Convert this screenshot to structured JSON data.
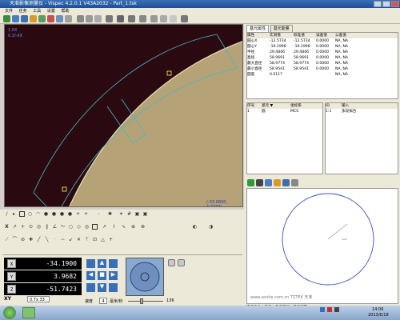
{
  "window": {
    "title": "天准影像测量仪 - Vispec 4.2.0.1 V43A2032 - Part_1.tsk"
  },
  "menu": [
    "文件",
    "任务",
    "工具",
    "设置",
    "帮助"
  ],
  "viewport": {
    "overlay_line1": "1.0X",
    "overlay_line2": "0.3/-XX",
    "cursor_readout": "(-33.0600, 3.7733)"
  },
  "right_panel": {
    "tabs": [
      "基元属性",
      "基元能量"
    ],
    "table_headers": [
      "属性",
      "实测值",
      "标准值",
      "误差值",
      "公差值"
    ],
    "rows": [
      [
        "圆心X",
        "-12.5734",
        "-12.5734",
        "0.0000",
        "NA, NA"
      ],
      [
        "圆心Y",
        "-16.1998",
        "-16.1998",
        "0.0000",
        "NA, NA"
      ],
      [
        "半径",
        "29.4846",
        "29.4846",
        "0.0000",
        "NA, NA"
      ],
      [
        "直径",
        "58.9691",
        "58.9691",
        "0.0000",
        "NA, NA"
      ],
      [
        "最大直径",
        "58.9774",
        "58.9774",
        "0.0000",
        "NA, NA"
      ],
      [
        "最小直径",
        "58.9541",
        "58.9541",
        "0.0000",
        "NA, NA"
      ],
      [
        "圆度",
        "0.0117",
        "",
        "",
        "NA, NA"
      ]
    ],
    "list1_headers": [
      "序号",
      "基元 ▼",
      "坐标系"
    ],
    "list1_rows": [
      [
        "1",
        "圆",
        "MCS"
      ]
    ],
    "list2_headers": [
      "ID",
      "输入"
    ],
    "list2_rows": [
      [
        "1:1",
        "多段拟合"
      ]
    ],
    "bottom_tabs": "操作指令 | 基元 | 参考平行 | 基元测量",
    "watermark": "www.sonhe.com.cn  TZTEK 天准"
  },
  "coords": {
    "x": "-34.1900",
    "y": "3.9682",
    "z": "-51.7423"
  },
  "bottom": {
    "zoom": "0.7x 33",
    "speed_label": "速度",
    "speed_value": "4",
    "unit": "毫米/秒",
    "light_value": "136"
  },
  "taskbar": {
    "time": "14:06",
    "date": "2013/6/18"
  }
}
